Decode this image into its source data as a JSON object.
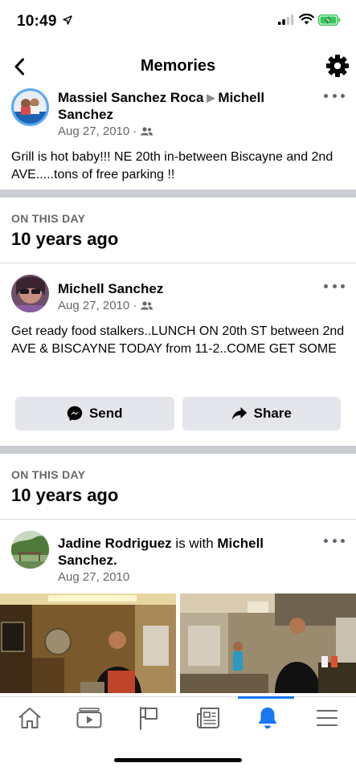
{
  "status_bar": {
    "time": "10:49",
    "battery_color": "#34c759"
  },
  "header": {
    "title": "Memories",
    "back_icon": "chevron-left-icon",
    "settings_icon": "gear-icon"
  },
  "posts": [
    {
      "author": "Massiel Sanchez Roca",
      "recipient": "Michell Sanchez",
      "date": "Aug 27, 2010 ·",
      "audience_icon": "friends-icon",
      "text": "Grill is hot baby!!! NE 20th in-between Biscayne and 2nd AVE.....tons of free parking !!"
    },
    {
      "section_label": "ON THIS DAY",
      "section_title": "10 years ago",
      "author": "Michell Sanchez",
      "date": "Aug 27, 2010 ·",
      "audience_icon": "friends-icon",
      "text": "Get ready food stalkers..LUNCH ON 20th ST between 2nd AVE & BISCAYNE TODAY from 11-2..COME GET SOME",
      "send_label": "Send",
      "share_label": "Share"
    },
    {
      "section_label": "ON THIS DAY",
      "section_title": "10 years ago",
      "author": "Jadine Rodriguez",
      "with_text": "is with",
      "tagged": "Michell Sanchez.",
      "date": "Aug 27, 2010"
    }
  ],
  "tabs": [
    {
      "name": "home",
      "icon": "home-icon"
    },
    {
      "name": "watch",
      "icon": "video-icon"
    },
    {
      "name": "pages",
      "icon": "flag-icon"
    },
    {
      "name": "news",
      "icon": "newspaper-icon"
    },
    {
      "name": "notifications",
      "icon": "bell-icon",
      "active": true
    },
    {
      "name": "menu",
      "icon": "menu-icon"
    }
  ],
  "colors": {
    "accent": "#1877f2",
    "secondary_text": "#65676b",
    "button_bg": "#e4e6eb"
  }
}
